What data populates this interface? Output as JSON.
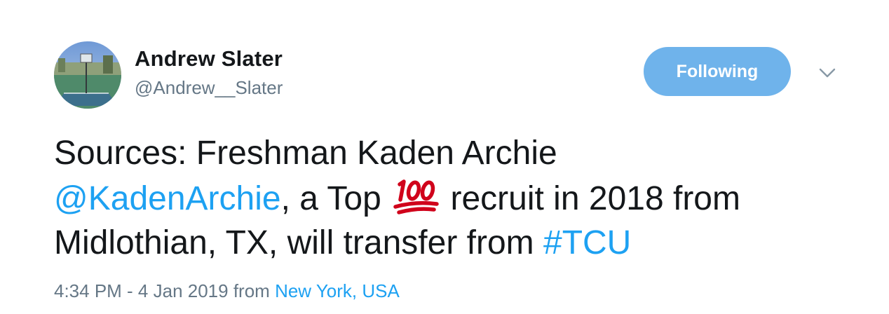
{
  "author": {
    "name": "Andrew Slater",
    "handle": "@Andrew__Slater"
  },
  "follow_button": {
    "label": "Following",
    "color": "#6fb3eb"
  },
  "menu_icon": "chevron-down-icon",
  "tweet": {
    "line1": "Sources: Freshman Kaden Archie",
    "mention": "@KadenArchie",
    "line2_mid": ", a Top ",
    "emoji": "hundred-points-emoji",
    "line2_end": " recruit in 2018 from",
    "line3_pre": "Midlothian, TX, will transfer from ",
    "hashtag": "#TCU"
  },
  "meta": {
    "timestamp": "4:34 PM - 4 Jan 2019",
    "from_label": " from ",
    "location": "New York, USA"
  },
  "colors": {
    "link": "#1da1f2",
    "secondary_text": "#657786",
    "primary_text": "#14171a",
    "emoji_red": "#d0021b"
  }
}
